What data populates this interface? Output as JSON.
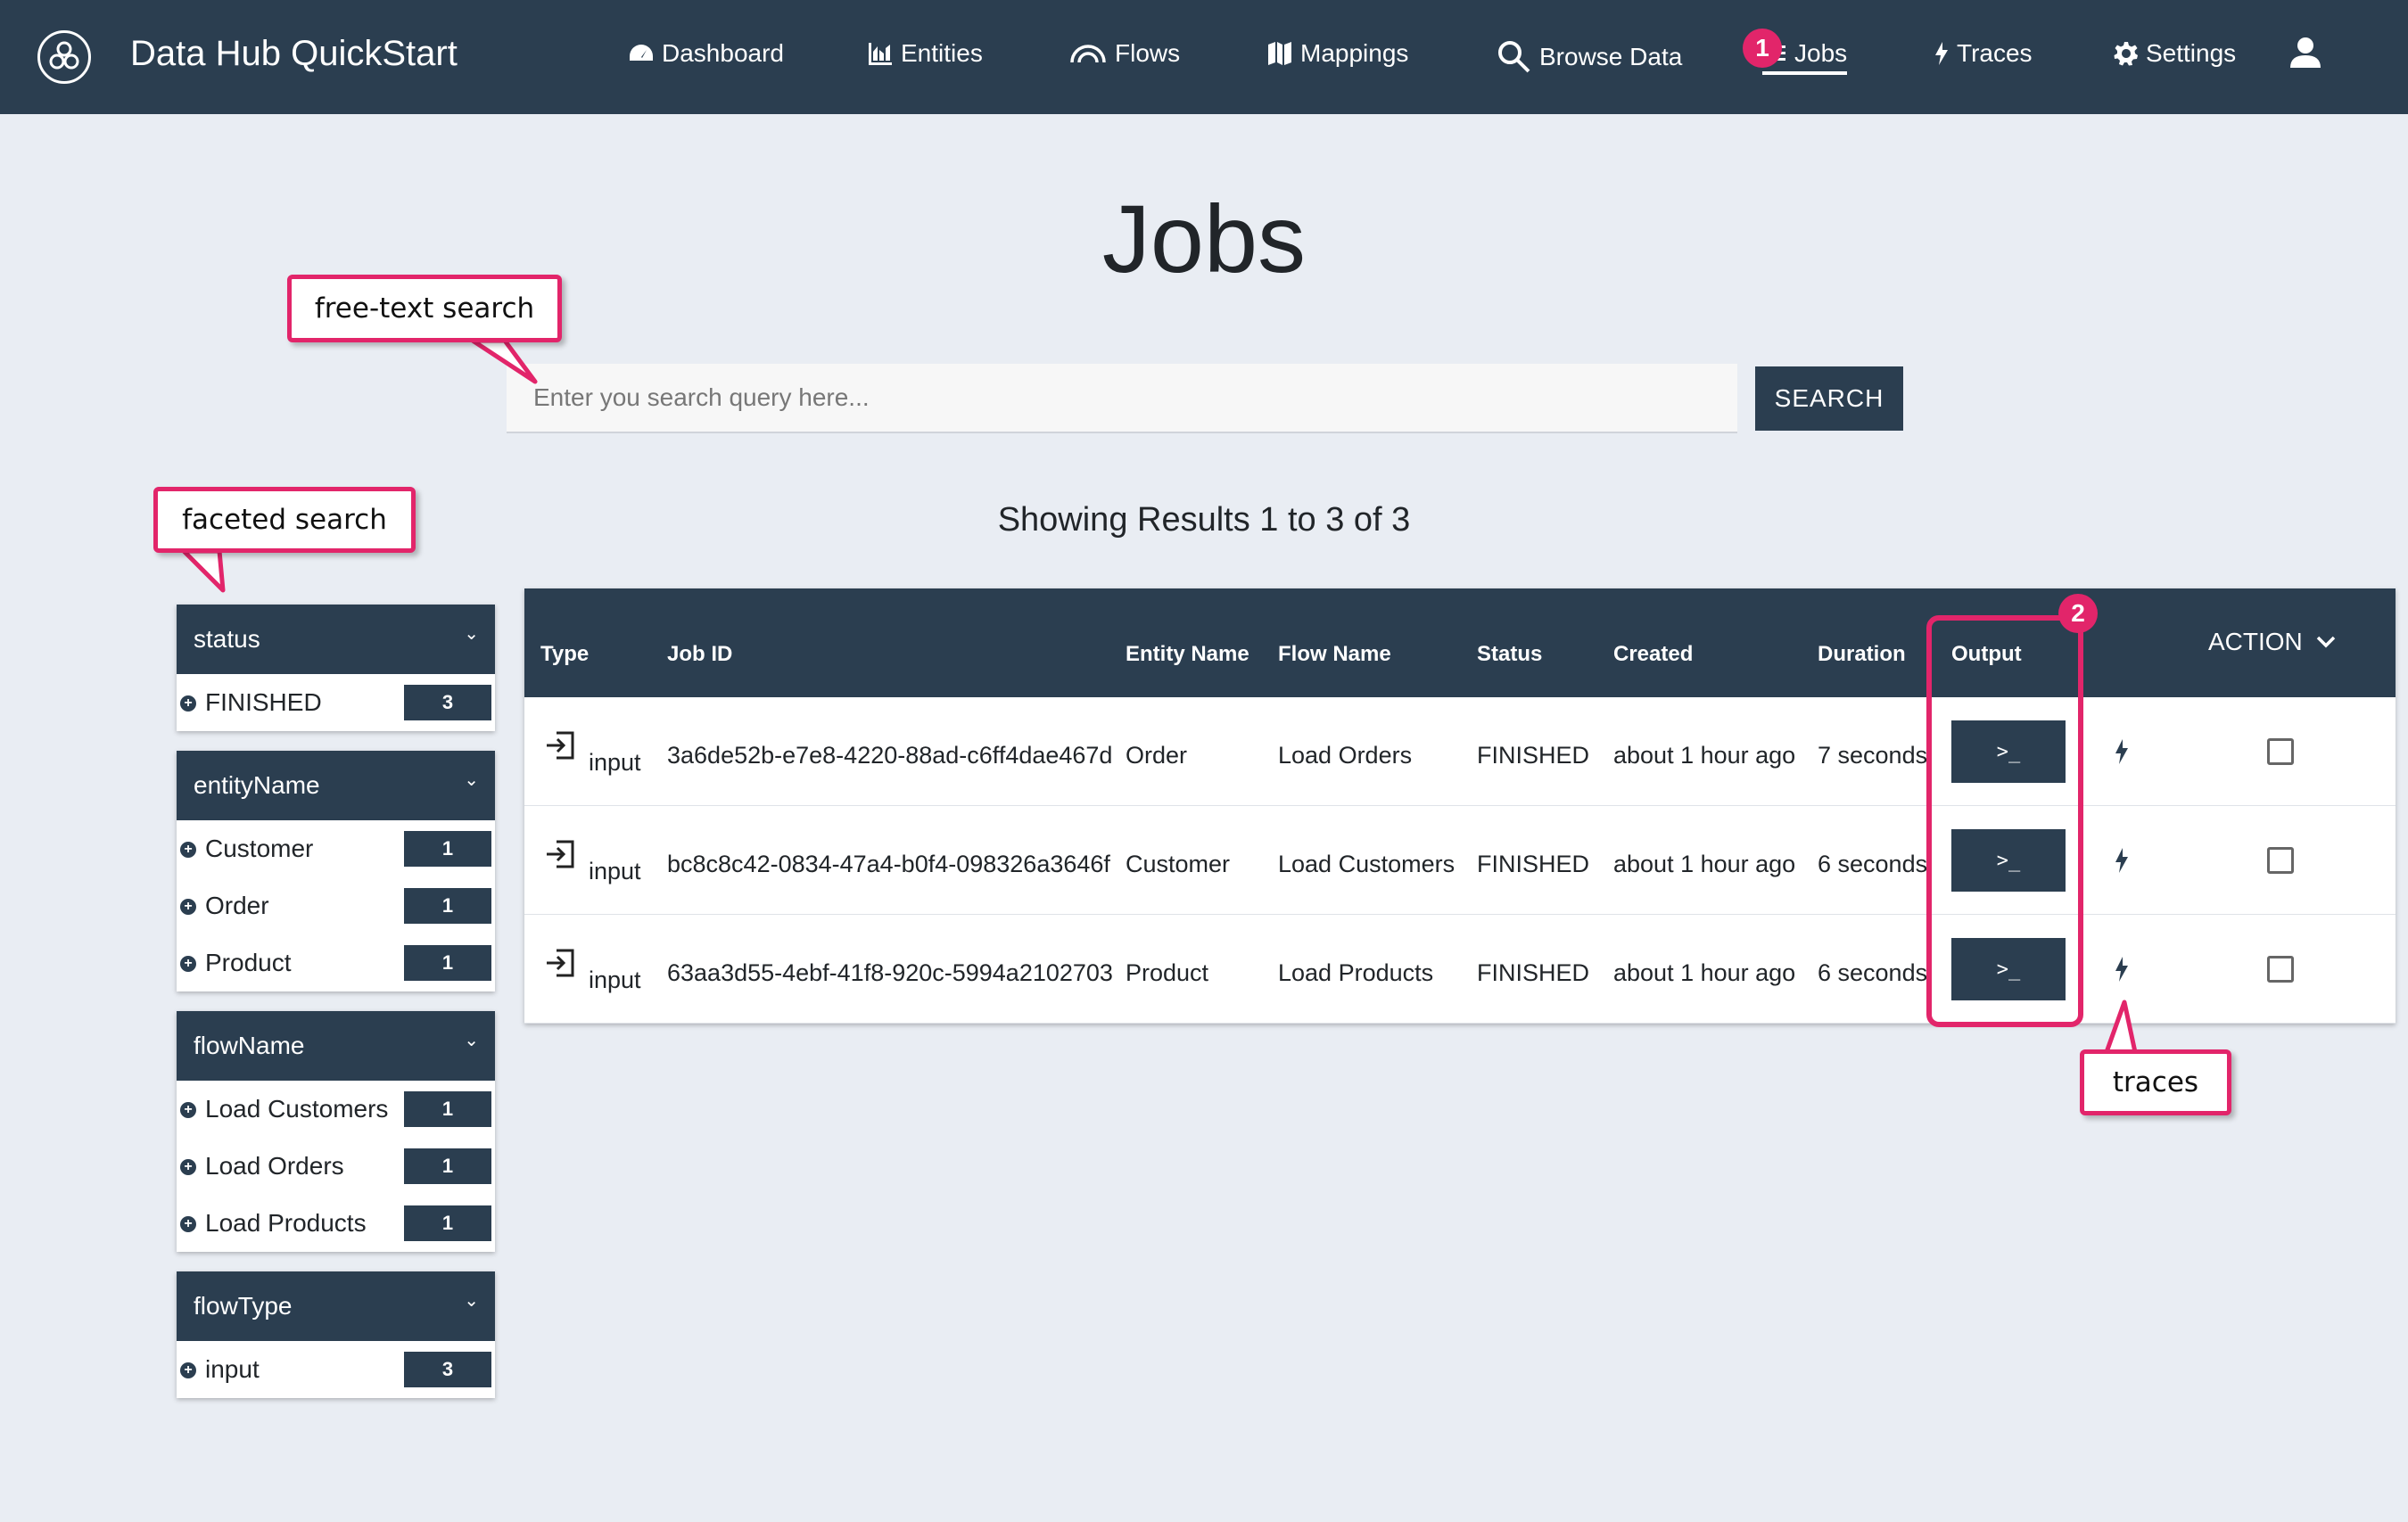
{
  "app": {
    "title": "Data Hub QuickStart"
  },
  "nav": {
    "items": [
      {
        "label": "Dashboard",
        "icon": "dashboard-icon"
      },
      {
        "label": "Entities",
        "icon": "chart-icon"
      },
      {
        "label": "Flows",
        "icon": "flows-icon"
      },
      {
        "label": "Mappings",
        "icon": "map-icon"
      },
      {
        "label": "Browse Data",
        "icon": "search-icon"
      },
      {
        "label": "Jobs",
        "icon": "jobs-icon",
        "active": true
      },
      {
        "label": "Traces",
        "icon": "bolt-icon"
      },
      {
        "label": "Settings",
        "icon": "gear-icon"
      }
    ],
    "user_icon": "user-icon"
  },
  "page": {
    "title": "Jobs"
  },
  "search": {
    "placeholder": "Enter you search query here...",
    "button_label": "SEARCH"
  },
  "results_text": "Showing Results 1 to 3 of 3",
  "annotations": {
    "free_text": "free-text search",
    "faceted": "faceted search",
    "traces": "traces",
    "badge_1": "1",
    "badge_2": "2"
  },
  "facets": [
    {
      "name": "status",
      "items": [
        {
          "label": "FINISHED",
          "count": "3"
        }
      ]
    },
    {
      "name": "entityName",
      "items": [
        {
          "label": "Customer",
          "count": "1"
        },
        {
          "label": "Order",
          "count": "1"
        },
        {
          "label": "Product",
          "count": "1"
        }
      ]
    },
    {
      "name": "flowName",
      "items": [
        {
          "label": "Load Customers",
          "count": "1"
        },
        {
          "label": "Load Orders",
          "count": "1"
        },
        {
          "label": "Load Products",
          "count": "1"
        }
      ]
    },
    {
      "name": "flowType",
      "items": [
        {
          "label": "input",
          "count": "3"
        }
      ]
    }
  ],
  "table": {
    "headers": [
      "Type",
      "Job ID",
      "Entity Name",
      "Flow Name",
      "Status",
      "Created",
      "Duration",
      "Output"
    ],
    "action_label": "ACTION",
    "output_button": ">_",
    "rows": [
      {
        "type": "input",
        "job_id": "3a6de52b-e7e8-4220-88ad-c6ff4dae467d",
        "entity": "Order",
        "flow": "Load Orders",
        "status": "FINISHED",
        "created": "about 1 hour ago",
        "duration": "7 seconds"
      },
      {
        "type": "input",
        "job_id": "bc8c8c42-0834-47a4-b0f4-098326a3646f",
        "entity": "Customer",
        "flow": "Load Customers",
        "status": "FINISHED",
        "created": "about 1 hour ago",
        "duration": "6 seconds"
      },
      {
        "type": "input",
        "job_id": "63aa3d55-4ebf-41f8-920c-5994a2102703",
        "entity": "Product",
        "flow": "Load Products",
        "status": "FINISHED",
        "created": "about 1 hour ago",
        "duration": "6 seconds"
      }
    ]
  },
  "colors": {
    "navbar": "#2b3e50",
    "accent": "#e2256a",
    "background": "#e9edf3"
  }
}
